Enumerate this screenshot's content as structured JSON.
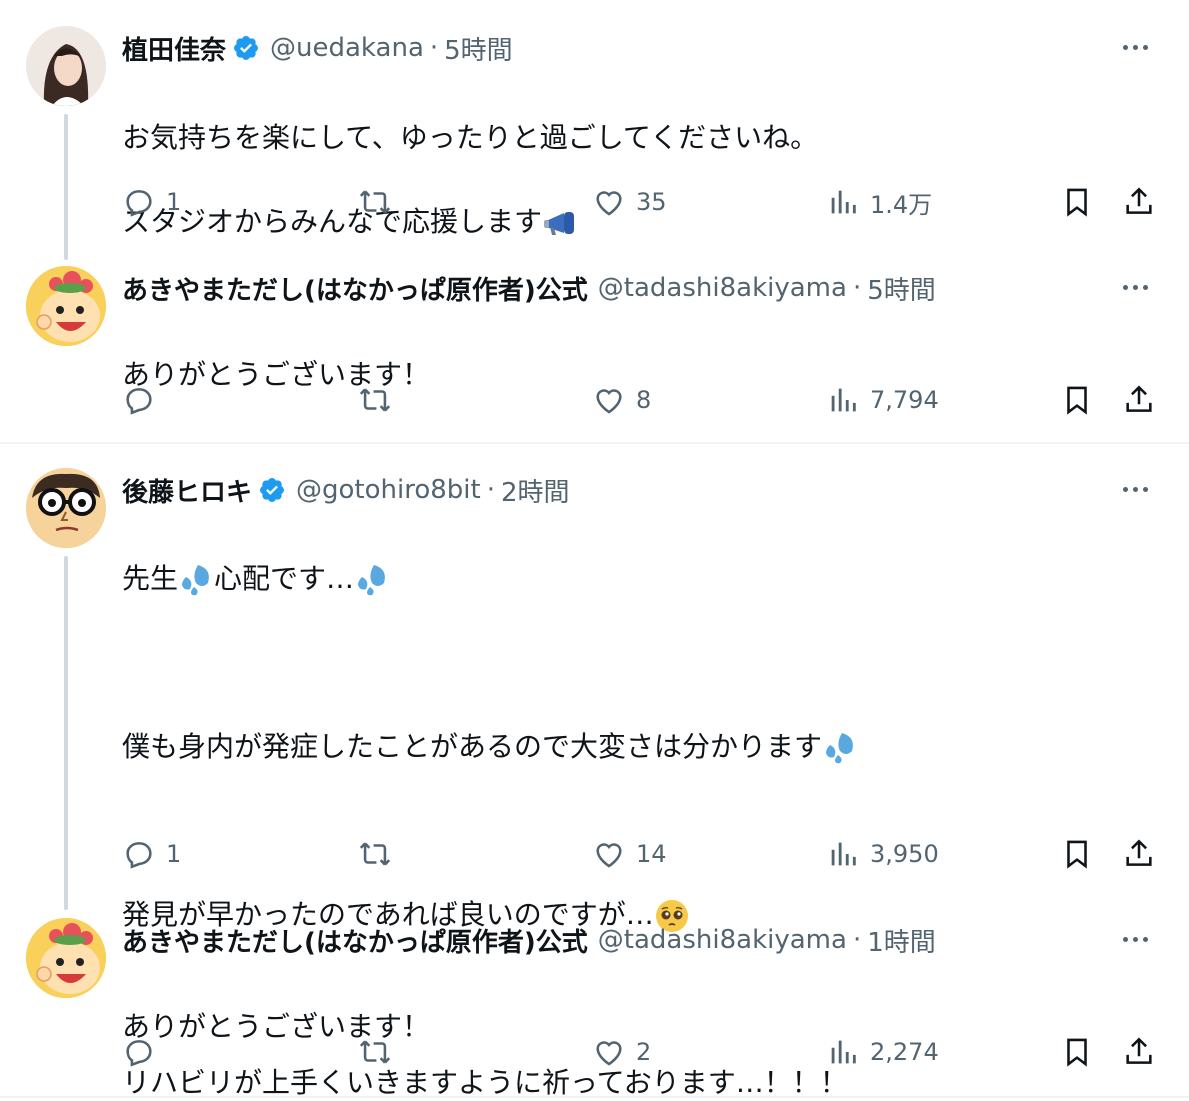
{
  "tweets": [
    {
      "name": "植田佳奈",
      "handle": "@uedakana",
      "time": "5時間",
      "verified": true,
      "lines": [
        "お気持ちを楽にして、ゆったりと過ごしてくださいね。",
        "スタジオからみんなで応援します"
      ],
      "reply_count": "1",
      "repost_count": "",
      "like_count": "35",
      "view_count": "1.4万",
      "avatar_icon": "woman-photo"
    },
    {
      "name": "あきやまただし(はなかっぱ原作者)公式",
      "handle": "@tadashi8akiyama",
      "time": "5時間",
      "verified": false,
      "lines": [
        "ありがとうございます！"
      ],
      "reply_count": "",
      "repost_count": "",
      "like_count": "8",
      "view_count": "7,794",
      "avatar_icon": "hanakappa-character"
    },
    {
      "name": "後藤ヒロキ",
      "handle": "@gotohiro8bit",
      "time": "2時間",
      "verified": true,
      "lines": [
        "先生",
        "心配です…",
        "僕も身内が発症したことがあるので大変さは分かります",
        "発見が早かったのであれば良いのですが…",
        "リハビリが上手くいきますように祈っております…！！！"
      ],
      "reply_count": "1",
      "repost_count": "",
      "like_count": "14",
      "view_count": "3,950",
      "avatar_icon": "glasses-character"
    },
    {
      "name": "あきやまただし(はなかっぱ原作者)公式",
      "handle": "@tadashi8akiyama",
      "time": "1時間",
      "verified": false,
      "lines": [
        "ありがとうございます！"
      ],
      "reply_count": "",
      "repost_count": "",
      "like_count": "2",
      "view_count": "2,274",
      "avatar_icon": "hanakappa-character"
    }
  ],
  "colors": {
    "text": "#0f1419",
    "secondary": "#536471",
    "verified": "#1d9bf0",
    "thread_line": "#cfd9de",
    "divider": "#eff3f4"
  }
}
